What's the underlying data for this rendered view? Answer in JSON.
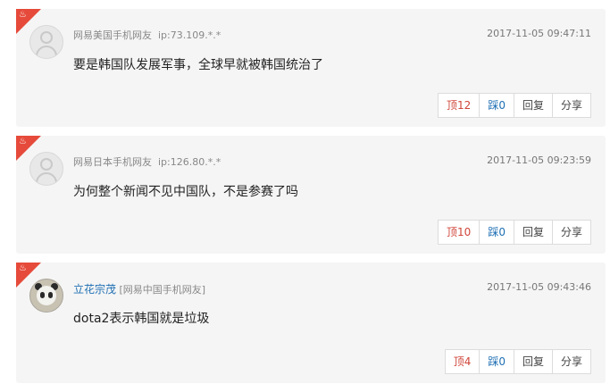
{
  "comments": [
    {
      "location": "网易美国手机网友",
      "ip": "ip:73.109.*.*",
      "time": "2017-11-05 09:47:11",
      "text": "要是韩国队发展军事，全球早就被韩国统治了",
      "up": "顶12",
      "down": "踩0",
      "reply": "回复",
      "share": "分享",
      "avatar": "default-avatar-icon"
    },
    {
      "location": "网易日本手机网友",
      "ip": "ip:126.80.*.*",
      "time": "2017-11-05 09:23:59",
      "text": "为何整个新闻不见中国队，不是参赛了吗",
      "up": "顶10",
      "down": "踩0",
      "reply": "回复",
      "share": "分享",
      "avatar": "default-avatar-icon"
    },
    {
      "username": "立花宗茂",
      "location": "[网易中国手机网友]",
      "time": "2017-11-05 09:43:46",
      "text": "dota2表示韩国就是垃圾",
      "up": "顶4",
      "down": "踩0",
      "reply": "回复",
      "share": "分享",
      "avatar": "panda-avatar"
    }
  ],
  "colors": {
    "hot_badge": "#e64a3a",
    "username": "#1e6fb3",
    "up": "#d0463a",
    "down": "#1e6fb3",
    "card_bg": "#f5f5f5"
  }
}
